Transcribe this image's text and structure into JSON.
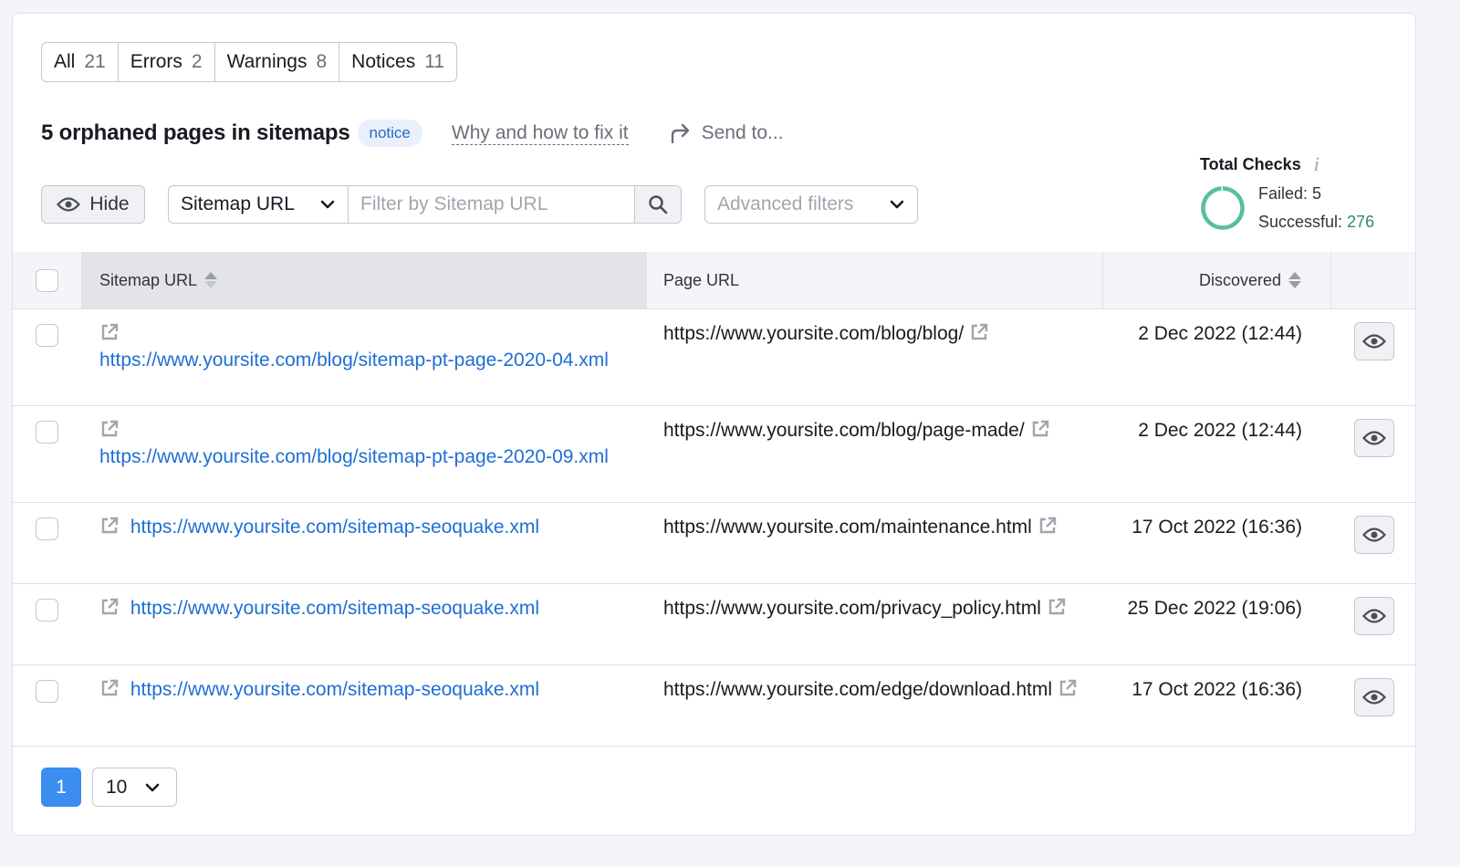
{
  "tabs": [
    {
      "label": "All",
      "count": "21"
    },
    {
      "label": "Errors",
      "count": "2"
    },
    {
      "label": "Warnings",
      "count": "8"
    },
    {
      "label": "Notices",
      "count": "11"
    }
  ],
  "issue": {
    "title": "5 orphaned pages in sitemaps",
    "badge": "notice",
    "fix_link": "Why and how to fix it",
    "send_to": "Send to..."
  },
  "filters": {
    "hide_label": "Hide",
    "select_value": "Sitemap URL",
    "input_placeholder": "Filter by Sitemap URL",
    "input_value": "",
    "advanced_label": "Advanced filters"
  },
  "total_checks": {
    "title": "Total Checks",
    "failed_label": "Failed:",
    "failed": "5",
    "successful_label": "Successful:",
    "successful": "276",
    "ring_color": "#5cbf97"
  },
  "table": {
    "columns": [
      "Sitemap URL",
      "Page URL",
      "Discovered"
    ],
    "rows": [
      {
        "sitemap_url": "https://www.yoursite.com/blog/sitemap-pt-page-2020-04.xml",
        "page_url": "https://www.yoursite.com/blog/blog/",
        "discovered": "2 Dec 2022 (12:44)"
      },
      {
        "sitemap_url": "https://www.yoursite.com/blog/sitemap-pt-page-2020-09.xml",
        "page_url": "https://www.yoursite.com/blog/page-made/",
        "discovered": "2 Dec 2022 (12:44)"
      },
      {
        "sitemap_url": "https://www.yoursite.com/sitemap-seoquake.xml",
        "page_url": "https://www.yoursite.com/maintenance.html",
        "discovered": "17 Oct 2022 (16:36)"
      },
      {
        "sitemap_url": "https://www.yoursite.com/sitemap-seoquake.xml",
        "page_url": "https://www.yoursite.com/privacy_policy.html",
        "discovered": "25 Dec 2022 (19:06)"
      },
      {
        "sitemap_url": "https://www.yoursite.com/sitemap-seoquake.xml",
        "page_url": "https://www.yoursite.com/edge/download.html",
        "discovered": "17 Oct 2022 (16:36)"
      }
    ]
  },
  "pagination": {
    "current_page": "1",
    "per_page": "10"
  },
  "colors": {
    "link": "#1f6ed4",
    "primary": "#3b8df0",
    "badge_bg": "#e9f0fb",
    "success": "#2f8a6c"
  }
}
